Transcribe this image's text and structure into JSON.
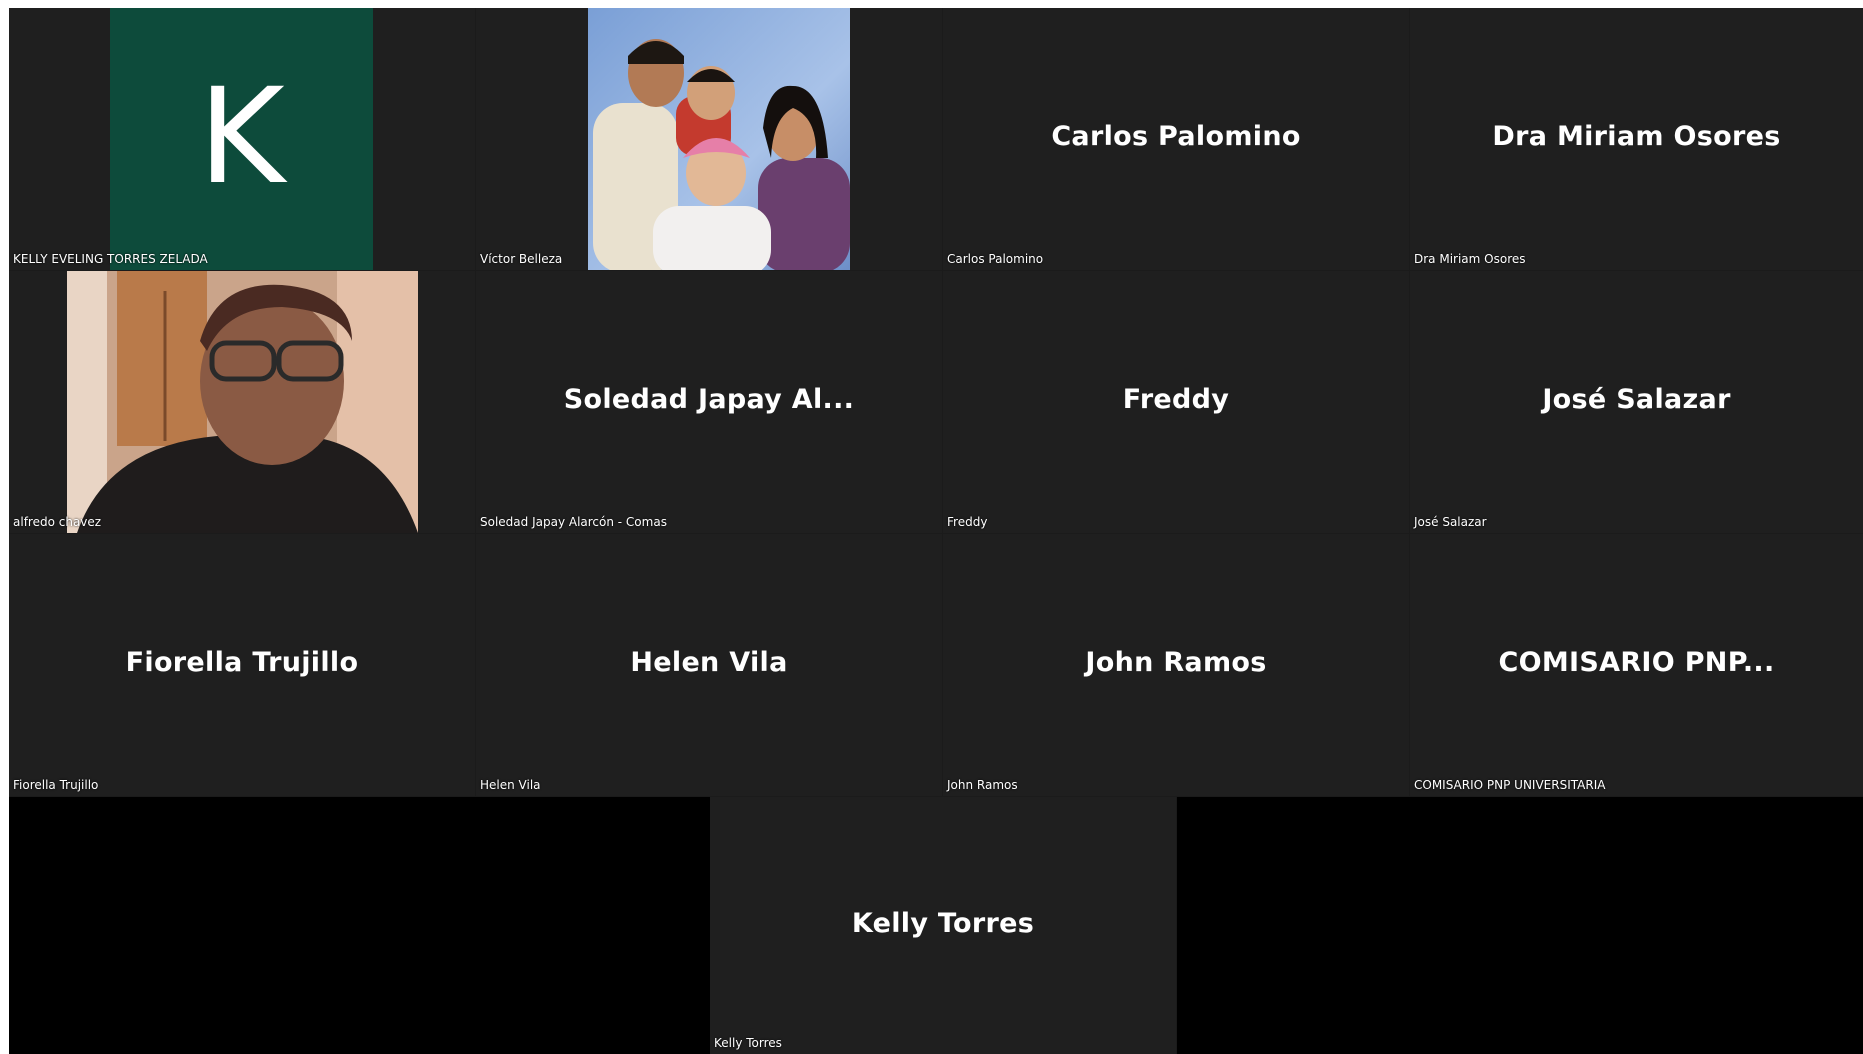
{
  "participants": [
    {
      "display": "",
      "label": "KELLY EVELING TORRES ZELADA",
      "avatar_letter": "K",
      "avatar_color": "#0d4b3b"
    },
    {
      "display": "",
      "label": "Víctor Belleza"
    },
    {
      "display": "Carlos Palomino",
      "label": "Carlos Palomino"
    },
    {
      "display": "Dra Miriam Osores",
      "label": "Dra Miriam Osores"
    },
    {
      "display": "",
      "label": "alfredo chavez"
    },
    {
      "display": "Soledad  Japay  Al...",
      "label": "Soledad Japay Alarcón - Comas"
    },
    {
      "display": "Freddy",
      "label": "Freddy"
    },
    {
      "display": "José Salazar",
      "label": "José Salazar"
    },
    {
      "display": "Fiorella Trujillo",
      "label": "Fiorella Trujillo"
    },
    {
      "display": "Helen Vila",
      "label": "Helen Vila"
    },
    {
      "display": "John Ramos",
      "label": "John Ramos"
    },
    {
      "display": "COMISARIO  PNP...",
      "label": "COMISARIO PNP UNIVERSITARIA"
    },
    {
      "display": "Kelly Torres",
      "label": "Kelly Torres"
    }
  ],
  "colors": {
    "tile_bg": "#1f1f1f",
    "grid_bg": "#1b1b1b",
    "text": "#ffffff"
  }
}
